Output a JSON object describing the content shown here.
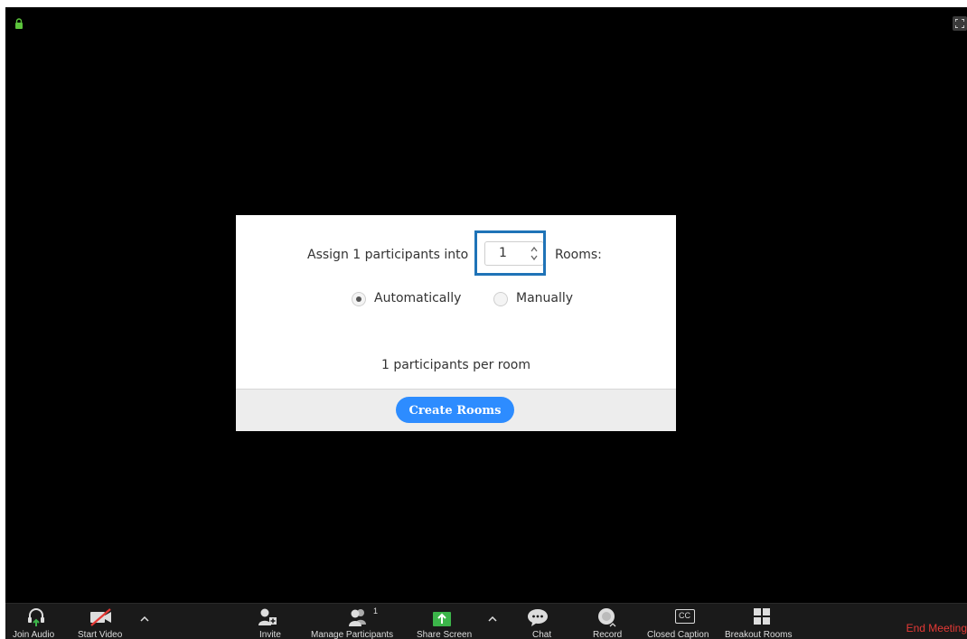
{
  "dialog": {
    "assign_prefix": "Assign 1 participants into",
    "room_count": "1",
    "rooms_suffix": "Rooms:",
    "option_auto": "Automatically",
    "option_manual": "Manually",
    "selected_option": "Automatically",
    "per_room_text": "1 participants per room",
    "create_button": "Create Rooms"
  },
  "toolbar": {
    "join_audio": "Join Audio",
    "start_video": "Start Video",
    "invite": "Invite",
    "manage_participants": "Manage Participants",
    "participant_count": "1",
    "share_screen": "Share Screen",
    "chat": "Chat",
    "record": "Record",
    "closed_caption": "Closed Caption",
    "cc_glyph": "CC",
    "breakout_rooms": "Breakout Rooms",
    "end_meeting": "End Meeting"
  },
  "colors": {
    "accent_blue": "#2d8cff",
    "highlight_border": "#1f73b7",
    "end_meeting_red": "#e53935",
    "share_green": "#3cb54a",
    "lock_green": "#5cc43c"
  }
}
